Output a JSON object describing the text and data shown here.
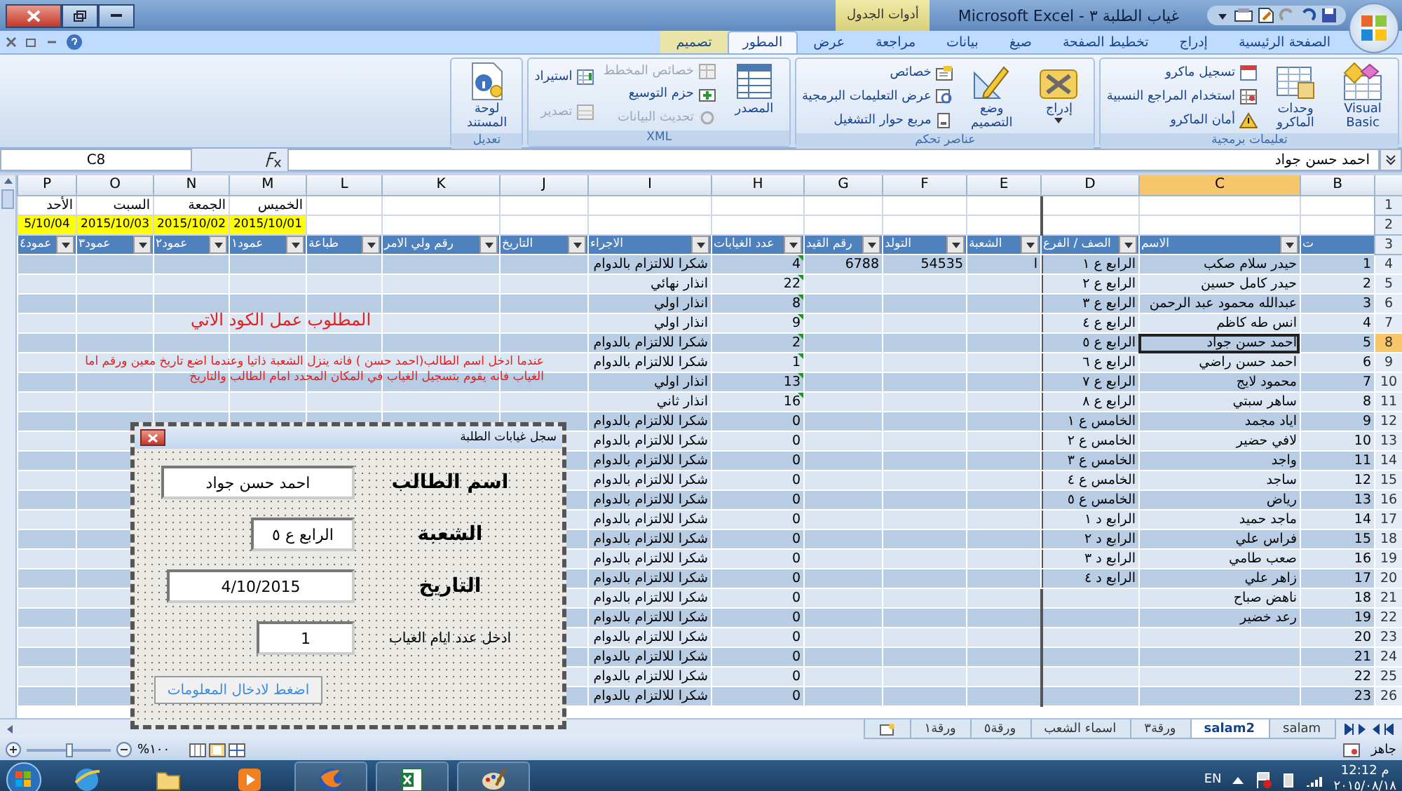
{
  "window": {
    "title": "غياب الطلبة ٣ - Microsoft Excel",
    "contextual_tab": "أدوات الجدول"
  },
  "tabs": [
    {
      "label": "الصفحة الرئيسية",
      "selected": false
    },
    {
      "label": "إدراج",
      "selected": false
    },
    {
      "label": "تخطيط الصفحة",
      "selected": false
    },
    {
      "label": "صيغ",
      "selected": false
    },
    {
      "label": "بيانات",
      "selected": false
    },
    {
      "label": "مراجعة",
      "selected": false
    },
    {
      "label": "عرض",
      "selected": false
    },
    {
      "label": "المطور",
      "selected": true
    },
    {
      "label": "تصميم",
      "selected": false
    }
  ],
  "ribbon_groups": [
    {
      "label": "تعليمات برمجية",
      "sections": [
        {
          "kind": "large",
          "label": "Visual Basic",
          "disabled": false
        },
        {
          "kind": "large",
          "label": "وحدات الماكرو",
          "disabled": false
        },
        {
          "kind": "stack",
          "items": [
            {
              "label": "تسجيل ماكرو",
              "disabled": false
            },
            {
              "label": "استخدام المراجع النسبية",
              "disabled": false
            },
            {
              "label": "أمان الماكرو",
              "disabled": false
            }
          ]
        }
      ]
    },
    {
      "label": "عناصر تحكم",
      "sections": [
        {
          "kind": "large",
          "label": "إدراج",
          "disabled": false,
          "dropdown": true
        },
        {
          "kind": "large",
          "label": "وضع التصميم",
          "disabled": false
        },
        {
          "kind": "stack",
          "items": [
            {
              "label": "خصائص",
              "disabled": false
            },
            {
              "label": "عرض التعليمات البرمجية",
              "disabled": false
            },
            {
              "label": "مربع حوار التشغيل",
              "disabled": false
            }
          ]
        }
      ]
    },
    {
      "label": "XML",
      "sections": [
        {
          "kind": "large",
          "label": "المصدر",
          "disabled": false
        },
        {
          "kind": "stack",
          "items": [
            {
              "label": "خصائص المخطط",
              "disabled": true
            },
            {
              "label": "حزم التوسيع",
              "disabled": false
            },
            {
              "label": "تحديث البيانات",
              "disabled": true
            }
          ]
        },
        {
          "kind": "stack",
          "items": [
            {
              "label": "استيراد",
              "disabled": false
            },
            {
              "label": "تصدير",
              "disabled": true
            }
          ]
        }
      ]
    },
    {
      "label": "تعديل",
      "sections": [
        {
          "kind": "large",
          "label": "لوحة المستند",
          "disabled": false
        }
      ]
    }
  ],
  "formula_bar": {
    "name_box": "C8",
    "value": "احمد حسن جواد"
  },
  "sheet": {
    "columns": [
      {
        "label": "B",
        "selected": false
      },
      {
        "label": "C",
        "selected": true
      },
      {
        "label": "D",
        "selected": false
      },
      {
        "label": "E",
        "selected": false
      },
      {
        "label": "F",
        "selected": false
      },
      {
        "label": "G",
        "selected": false
      },
      {
        "label": "H",
        "selected": false
      },
      {
        "label": "I",
        "selected": false
      },
      {
        "label": "J",
        "selected": false
      },
      {
        "label": "K",
        "selected": false
      },
      {
        "label": "L",
        "selected": false
      },
      {
        "label": "M",
        "selected": false
      },
      {
        "label": "N",
        "selected": false
      },
      {
        "label": "O",
        "selected": false
      },
      {
        "label": "P",
        "selected": false
      }
    ],
    "top_rows": [
      "1",
      "2",
      "3"
    ],
    "day_names": [
      "الخميس",
      "الجمعة",
      "السبت",
      "الأحد"
    ],
    "dates": [
      "2015/10/01",
      "2015/10/02",
      "2015/10/03",
      "5/10/04"
    ],
    "headers": [
      {
        "label": "ت",
        "filter": false
      },
      {
        "label": "الاسم",
        "filter": true
      },
      {
        "label": "الصف / الفرع",
        "filter": true
      },
      {
        "label": "الشعبة",
        "filter": true
      },
      {
        "label": "التولد",
        "filter": true
      },
      {
        "label": "رقم القيد",
        "filter": true
      },
      {
        "label": "عدد الغيابات",
        "filter": true
      },
      {
        "label": "الاجراء",
        "filter": true
      },
      {
        "label": "التاريخ",
        "filter": true
      },
      {
        "label": "رقم ولي الامر",
        "filter": true
      },
      {
        "label": "طباعة",
        "filter": true
      },
      {
        "label": "عمود١",
        "filter": true
      },
      {
        "label": "عمود٢",
        "filter": true
      },
      {
        "label": "عمود٣",
        "filter": true
      },
      {
        "label": "عمود٤",
        "filter": true
      }
    ],
    "rows": [
      {
        "row": "4",
        "number": "1",
        "name": "حيدر سلام صكب",
        "class": "الرابع ع ١",
        "section": "ا",
        "birth": "54535",
        "reg_no": "6788",
        "absences": "4",
        "action": "شكرا للالتزام بالدوام",
        "marked": true,
        "selected": false
      },
      {
        "row": "5",
        "number": "2",
        "name": "حيدر كامل حسين",
        "class": "الرابع ع ٢",
        "absences": "22",
        "action": "انذار نهائي",
        "marked": true,
        "selected": false
      },
      {
        "row": "6",
        "number": "3",
        "name": "عبدالله محمود عبد الرحمن",
        "class": "الرابع ع ٣",
        "absences": "8",
        "action": "انذار اولي",
        "marked": true,
        "selected": false
      },
      {
        "row": "7",
        "number": "4",
        "name": "انس طه كاظم",
        "class": "الرابع ع ٤",
        "absences": "9",
        "action": "انذار اولي",
        "marked": true,
        "selected": false
      },
      {
        "row": "8",
        "number": "5",
        "name": "احمد حسن جواد",
        "class": "الرابع ع ٥",
        "absences": "2",
        "action": "شكرا للالتزام بالدوام",
        "marked": true,
        "selected": true
      },
      {
        "row": "9",
        "number": "6",
        "name": "احمد حسن راضي",
        "class": "الرابع ع ٦",
        "absences": "1",
        "action": "شكرا للالتزام بالدوام",
        "marked": true,
        "selected": false
      },
      {
        "row": "10",
        "number": "7",
        "name": "محمود لايج",
        "class": "الرابع ع ٧",
        "absences": "13",
        "action": "انذار اولي",
        "marked": true,
        "selected": false
      },
      {
        "row": "11",
        "number": "8",
        "name": "ساهر سبتي",
        "class": "الرابع ع ٨",
        "absences": "16",
        "action": "انذار ثاني",
        "marked": true,
        "selected": false
      },
      {
        "row": "12",
        "number": "9",
        "name": "اياد مجمد",
        "class": "الخامس ع ١",
        "absences": "0",
        "action": "شكرا للالتزام بالدوام",
        "marked": false,
        "selected": false
      },
      {
        "row": "13",
        "number": "10",
        "name": "لافي حضير",
        "class": "الخامس ع ٢",
        "absences": "0",
        "action": "شكرا للالتزام بالدوام",
        "marked": false,
        "selected": false
      },
      {
        "row": "14",
        "number": "11",
        "name": "واجد",
        "class": "الخامس ع ٣",
        "absences": "0",
        "action": "شكرا للالتزام بالدوام",
        "marked": false,
        "selected": false
      },
      {
        "row": "15",
        "number": "12",
        "name": "ساجد",
        "class": "الخامس ع ٤",
        "absences": "0",
        "action": "شكرا للالتزام بالدوام",
        "marked": false,
        "selected": false
      },
      {
        "row": "16",
        "number": "13",
        "name": "رياض",
        "class": "الخامس ع ٥",
        "absences": "0",
        "action": "شكرا للالتزام بالدوام",
        "marked": false,
        "selected": false
      },
      {
        "row": "17",
        "number": "14",
        "name": "ماجد حميد",
        "class": "الرابع د ١",
        "absences": "0",
        "action": "شكرا للالتزام بالدوام",
        "marked": false,
        "selected": false
      },
      {
        "row": "18",
        "number": "15",
        "name": "فراس علي",
        "class": "الرابع د ٢",
        "absences": "0",
        "action": "شكرا للالتزام بالدوام",
        "marked": false,
        "selected": false
      },
      {
        "row": "19",
        "number": "16",
        "name": "صعب طامي",
        "class": "الرابع د ٣",
        "absences": "0",
        "action": "شكرا للالتزام بالدوام",
        "marked": false,
        "selected": false
      },
      {
        "row": "20",
        "number": "17",
        "name": "زاهر علي",
        "class": "الرابع د ٤",
        "absences": "0",
        "action": "شكرا للالتزام بالدوام",
        "marked": false,
        "selected": false
      },
      {
        "row": "21",
        "number": "18",
        "name": "ناهض صباح",
        "absences": "0",
        "action": "شكرا للالتزام بالدوام",
        "marked": false,
        "selected": false
      },
      {
        "row": "22",
        "number": "19",
        "name": "رعد خضير",
        "absences": "0",
        "action": "شكرا للالتزام بالدوام",
        "marked": false,
        "selected": false
      },
      {
        "row": "23",
        "number": "20",
        "absences": "0",
        "action": "شكرا للالتزام بالدوام",
        "marked": false,
        "selected": false
      },
      {
        "row": "24",
        "number": "21",
        "absences": "0",
        "action": "شكرا للالتزام بالدوام",
        "marked": false,
        "selected": false
      },
      {
        "row": "25",
        "number": "22",
        "absences": "0",
        "action": "شكرا للالتزام بالدوام",
        "marked": false,
        "selected": false
      },
      {
        "row": "26",
        "number": "23",
        "absences": "0",
        "action": "شكرا للالتزام بالدوام",
        "marked": false,
        "selected": false
      }
    ],
    "notes": [
      "المطلوب عمل الكود الاتي",
      "عندما ادخل اسم الطالب(احمد حسن ) فانه ينزل الشعبة ذاتيا وعندما اضع تاريخ معين ورقم اما الغياب فانه يقوم بتسجيل الغياب في المكان المحدد امام الطالب والتاريخ"
    ]
  },
  "user_form": {
    "title": "سجل غيابات الطلبة",
    "fields": [
      {
        "label": "اسم الطالب",
        "value": "احمد حسن جواد"
      },
      {
        "label": "الشعبة",
        "value": "الرابع ع ٥"
      },
      {
        "label": "التاريخ",
        "value": "4/10/2015"
      },
      {
        "label": "ادخل عدد ايام الغياب",
        "value": "1"
      }
    ],
    "button": "اضغط لادخال المعلومات"
  },
  "sheet_tabs": [
    {
      "label": "salam",
      "selected": false
    },
    {
      "label": "salam2",
      "selected": true
    },
    {
      "label": "ورقة٣",
      "selected": false
    },
    {
      "label": "اسماء الشعب",
      "selected": false
    },
    {
      "label": "ورقة٥",
      "selected": false
    },
    {
      "label": "ورقة١",
      "selected": false
    }
  ],
  "status_bar": {
    "status": "جاهز",
    "zoom": "%١٠٠",
    "zoom_level": {
      "level": 0.5
    }
  },
  "taskbar": {
    "language": "EN",
    "time": "12:12 م",
    "date": "٢٠١٥/٠٨/١٨"
  }
}
